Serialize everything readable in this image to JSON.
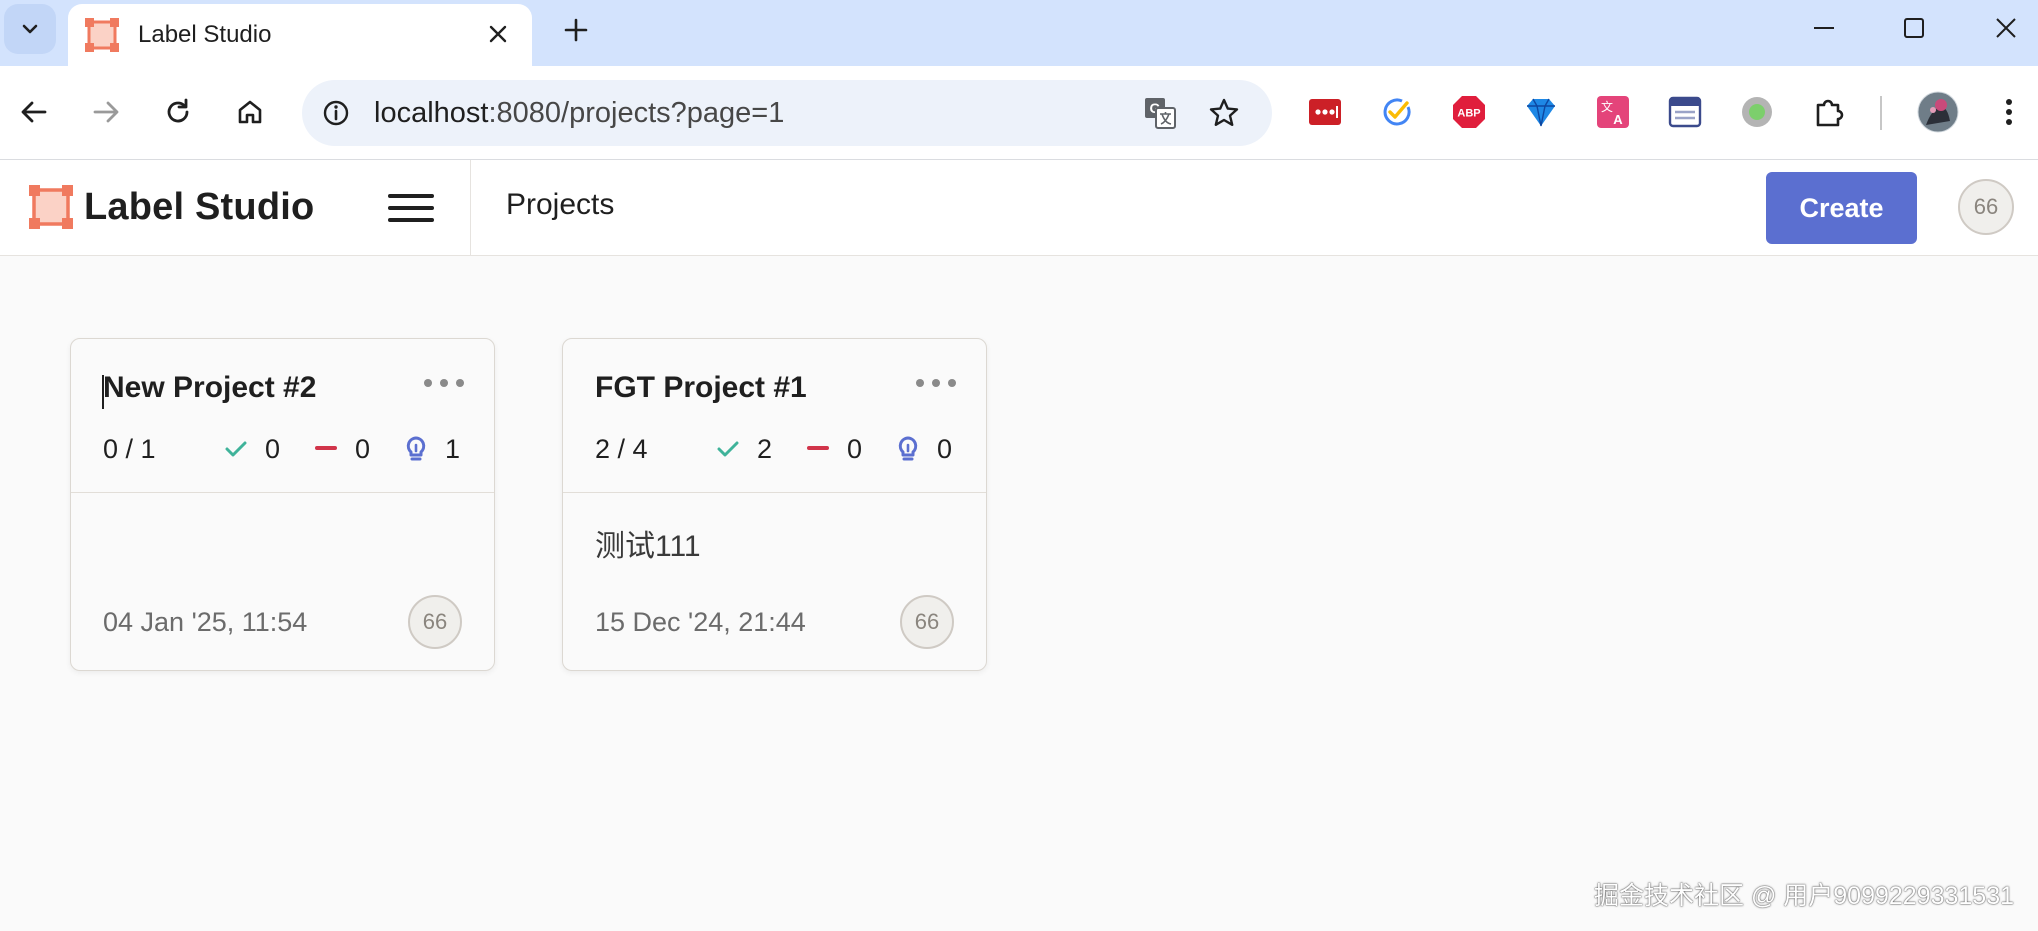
{
  "browser": {
    "tab_title": "Label Studio",
    "url_host": "localhost",
    "url_path": ":8080/projects?page=1",
    "extensions": [
      "lastpass-icon",
      "task-check-icon",
      "adblock-plus-icon",
      "gem-icon",
      "translate-ext-icon",
      "reader-icon",
      "status-dot-icon",
      "puzzle-extensions-icon"
    ]
  },
  "app": {
    "brand": "Label Studio",
    "page_title": "Projects",
    "create_label": "Create",
    "user_initials": "66",
    "colors": {
      "accent": "#5b6fd0",
      "brand": "#f07a5f",
      "completed": "#3fb39a",
      "skipped": "#d1344a",
      "predictions": "#5b6fd0"
    }
  },
  "projects": [
    {
      "title": "New Project #2",
      "progress": "0 / 1",
      "completed": "0",
      "skipped": "0",
      "predictions": "1",
      "description": "",
      "date": "04 Jan '25, 11:54",
      "owner_initials": "66"
    },
    {
      "title": "FGT Project #1",
      "progress": "2 / 4",
      "completed": "2",
      "skipped": "0",
      "predictions": "0",
      "description": "测试111",
      "date": "15 Dec '24, 21:44",
      "owner_initials": "66"
    }
  ],
  "watermark": "掘金技术社区 @ 用户9099229331531"
}
